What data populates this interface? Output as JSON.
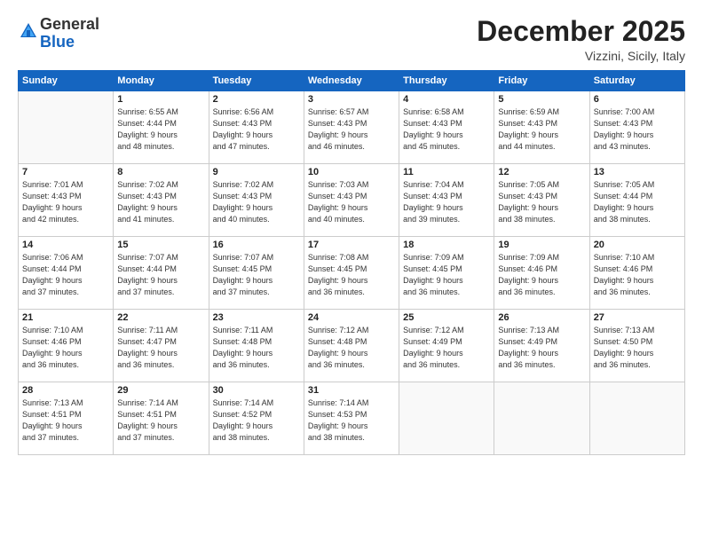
{
  "logo": {
    "general": "General",
    "blue": "Blue"
  },
  "header": {
    "month": "December 2025",
    "location": "Vizzini, Sicily, Italy"
  },
  "weekdays": [
    "Sunday",
    "Monday",
    "Tuesday",
    "Wednesday",
    "Thursday",
    "Friday",
    "Saturday"
  ],
  "weeks": [
    [
      {
        "day": "",
        "info": ""
      },
      {
        "day": "1",
        "info": "Sunrise: 6:55 AM\nSunset: 4:44 PM\nDaylight: 9 hours\nand 48 minutes."
      },
      {
        "day": "2",
        "info": "Sunrise: 6:56 AM\nSunset: 4:43 PM\nDaylight: 9 hours\nand 47 minutes."
      },
      {
        "day": "3",
        "info": "Sunrise: 6:57 AM\nSunset: 4:43 PM\nDaylight: 9 hours\nand 46 minutes."
      },
      {
        "day": "4",
        "info": "Sunrise: 6:58 AM\nSunset: 4:43 PM\nDaylight: 9 hours\nand 45 minutes."
      },
      {
        "day": "5",
        "info": "Sunrise: 6:59 AM\nSunset: 4:43 PM\nDaylight: 9 hours\nand 44 minutes."
      },
      {
        "day": "6",
        "info": "Sunrise: 7:00 AM\nSunset: 4:43 PM\nDaylight: 9 hours\nand 43 minutes."
      }
    ],
    [
      {
        "day": "7",
        "info": "Sunrise: 7:01 AM\nSunset: 4:43 PM\nDaylight: 9 hours\nand 42 minutes."
      },
      {
        "day": "8",
        "info": "Sunrise: 7:02 AM\nSunset: 4:43 PM\nDaylight: 9 hours\nand 41 minutes."
      },
      {
        "day": "9",
        "info": "Sunrise: 7:02 AM\nSunset: 4:43 PM\nDaylight: 9 hours\nand 40 minutes."
      },
      {
        "day": "10",
        "info": "Sunrise: 7:03 AM\nSunset: 4:43 PM\nDaylight: 9 hours\nand 40 minutes."
      },
      {
        "day": "11",
        "info": "Sunrise: 7:04 AM\nSunset: 4:43 PM\nDaylight: 9 hours\nand 39 minutes."
      },
      {
        "day": "12",
        "info": "Sunrise: 7:05 AM\nSunset: 4:43 PM\nDaylight: 9 hours\nand 38 minutes."
      },
      {
        "day": "13",
        "info": "Sunrise: 7:05 AM\nSunset: 4:44 PM\nDaylight: 9 hours\nand 38 minutes."
      }
    ],
    [
      {
        "day": "14",
        "info": "Sunrise: 7:06 AM\nSunset: 4:44 PM\nDaylight: 9 hours\nand 37 minutes."
      },
      {
        "day": "15",
        "info": "Sunrise: 7:07 AM\nSunset: 4:44 PM\nDaylight: 9 hours\nand 37 minutes."
      },
      {
        "day": "16",
        "info": "Sunrise: 7:07 AM\nSunset: 4:45 PM\nDaylight: 9 hours\nand 37 minutes."
      },
      {
        "day": "17",
        "info": "Sunrise: 7:08 AM\nSunset: 4:45 PM\nDaylight: 9 hours\nand 36 minutes."
      },
      {
        "day": "18",
        "info": "Sunrise: 7:09 AM\nSunset: 4:45 PM\nDaylight: 9 hours\nand 36 minutes."
      },
      {
        "day": "19",
        "info": "Sunrise: 7:09 AM\nSunset: 4:46 PM\nDaylight: 9 hours\nand 36 minutes."
      },
      {
        "day": "20",
        "info": "Sunrise: 7:10 AM\nSunset: 4:46 PM\nDaylight: 9 hours\nand 36 minutes."
      }
    ],
    [
      {
        "day": "21",
        "info": "Sunrise: 7:10 AM\nSunset: 4:46 PM\nDaylight: 9 hours\nand 36 minutes."
      },
      {
        "day": "22",
        "info": "Sunrise: 7:11 AM\nSunset: 4:47 PM\nDaylight: 9 hours\nand 36 minutes."
      },
      {
        "day": "23",
        "info": "Sunrise: 7:11 AM\nSunset: 4:48 PM\nDaylight: 9 hours\nand 36 minutes."
      },
      {
        "day": "24",
        "info": "Sunrise: 7:12 AM\nSunset: 4:48 PM\nDaylight: 9 hours\nand 36 minutes."
      },
      {
        "day": "25",
        "info": "Sunrise: 7:12 AM\nSunset: 4:49 PM\nDaylight: 9 hours\nand 36 minutes."
      },
      {
        "day": "26",
        "info": "Sunrise: 7:13 AM\nSunset: 4:49 PM\nDaylight: 9 hours\nand 36 minutes."
      },
      {
        "day": "27",
        "info": "Sunrise: 7:13 AM\nSunset: 4:50 PM\nDaylight: 9 hours\nand 36 minutes."
      }
    ],
    [
      {
        "day": "28",
        "info": "Sunrise: 7:13 AM\nSunset: 4:51 PM\nDaylight: 9 hours\nand 37 minutes."
      },
      {
        "day": "29",
        "info": "Sunrise: 7:14 AM\nSunset: 4:51 PM\nDaylight: 9 hours\nand 37 minutes."
      },
      {
        "day": "30",
        "info": "Sunrise: 7:14 AM\nSunset: 4:52 PM\nDaylight: 9 hours\nand 38 minutes."
      },
      {
        "day": "31",
        "info": "Sunrise: 7:14 AM\nSunset: 4:53 PM\nDaylight: 9 hours\nand 38 minutes."
      },
      {
        "day": "",
        "info": ""
      },
      {
        "day": "",
        "info": ""
      },
      {
        "day": "",
        "info": ""
      }
    ]
  ]
}
